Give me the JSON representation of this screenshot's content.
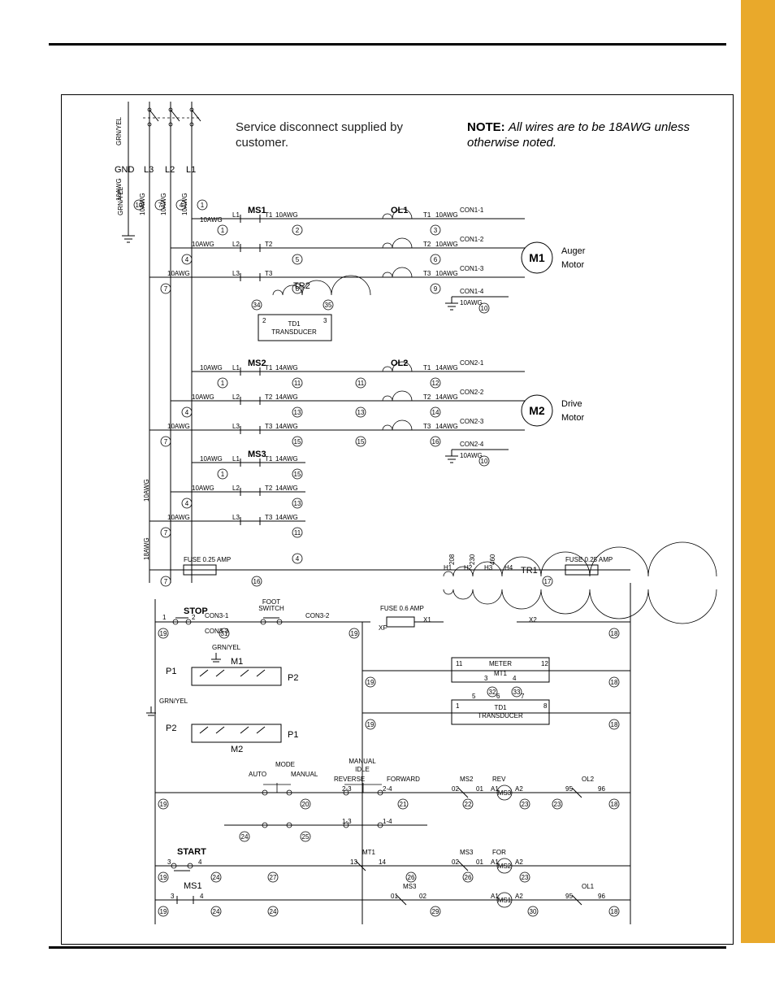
{
  "header": {
    "service": "Service disconnect supplied by customer.",
    "note_label": "NOTE:",
    "note_body": "All wires are to be 18AWG unless otherwise noted."
  },
  "power": {
    "gnd": "GND",
    "lines": [
      "L3",
      "L2",
      "L1"
    ],
    "grnyel": "GRN/YEL",
    "awg10": "10AWG",
    "awg14": "14AWG",
    "awg18": "18AWG"
  },
  "starters": [
    {
      "name": "MS1",
      "ol": "OL1",
      "con_pre": "CON1-",
      "motor": "M1",
      "motor_label": "Auger\nMotor",
      "rows": [
        {
          "L": "L1",
          "T": "T1",
          "left_w": "1",
          "mid_w": "2",
          "right_w": "3",
          "con": "1"
        },
        {
          "L": "L2",
          "T": "T2",
          "left_w": "4",
          "mid_w": "5",
          "right_w": "6",
          "con": "2"
        },
        {
          "L": "L3",
          "T": "T3",
          "left_w": "7",
          "mid_w": "8",
          "right_w": "9",
          "con": "3"
        }
      ],
      "gnd_w": "10",
      "tr": {
        "name": "TR2",
        "left_w": "34",
        "right_w": "35",
        "sub": "TD1\nTRANSDUCER",
        "t2": "2",
        "t3": "3"
      }
    },
    {
      "name": "MS2",
      "ol": "OL2",
      "con_pre": "CON2-",
      "motor": "M2",
      "motor_label": "Drive\nMotor",
      "rows": [
        {
          "L": "L1",
          "T": "T1",
          "left_w": "1",
          "mid_w": "11",
          "right_w": "12",
          "con": "1"
        },
        {
          "L": "L2",
          "T": "T2",
          "left_w": "4",
          "mid_w": "13",
          "right_w": "14",
          "con": "2"
        },
        {
          "L": "L3",
          "T": "T3",
          "left_w": "7",
          "mid_w": "15",
          "right_w": "16",
          "con": "3"
        }
      ],
      "gnd_w": "10"
    },
    {
      "name": "MS3",
      "rows": [
        {
          "L": "L1",
          "T": "T1",
          "left_w": "1",
          "mid_w": "15"
        },
        {
          "L": "L2",
          "T": "T2",
          "left_w": "4",
          "mid_w": "13"
        },
        {
          "L": "L3",
          "T": "T3",
          "left_w": "7",
          "mid_w": "11"
        }
      ]
    }
  ],
  "fuse_line": {
    "fuse_l": "FUSE 0.25 AMP",
    "fuse_r": "FUSE 0.25 AMP",
    "wires": {
      "l": "7",
      "rl": "16",
      "rr": "17",
      "top": "4"
    },
    "trans": {
      "name": "TR1",
      "h": [
        "H1",
        "H2",
        "H3",
        "H4"
      ],
      "v": [
        "208",
        "230",
        "460"
      ]
    }
  },
  "control": {
    "stop": {
      "label": "STOP",
      "n1": "1",
      "n2": "2",
      "foot": "FOOT\nSWITCH",
      "con31": "CON3-1",
      "con32": "CON3-2",
      "con33": "CON3-3",
      "wires": {
        "l": "19",
        "r": "19",
        "mid": "31"
      },
      "grnyel": "GRN/YEL"
    },
    "xfuse": {
      "label": "FUSE 0.6 AMP",
      "xf": "XF",
      "x1": "X1",
      "x2": "X2",
      "w18": "18"
    },
    "meter": {
      "label": "METER",
      "mt1": "MT1",
      "n11": "11",
      "n12": "12",
      "n3": "3",
      "n4": "4",
      "wl": "32",
      "wr": "33",
      "w19": "19",
      "w18": "18"
    },
    "td1": {
      "label": "TD1\nTRANSDUCER",
      "n1": "1",
      "n5": "5",
      "n6": "6",
      "n7": "7",
      "n8": "8",
      "w19": "19",
      "w18": "18"
    },
    "plugs": {
      "p1": "P1",
      "p2": "P2",
      "m1": "M1",
      "m2": "M2",
      "grnyel": "GRN/YEL"
    },
    "mode": {
      "label": "MODE",
      "auto": "AUTO",
      "manual": "MANUAL",
      "idle": "IDLE",
      "forward": "FORWARD",
      "reverse": "REVERSE",
      "w19": "19",
      "w20": "20",
      "w21": "21",
      "w24": "24",
      "w25": "25",
      "n23": "2-3",
      "n24": "2-4",
      "n13": "1-3",
      "n14": "1-4"
    },
    "rev_row": {
      "ms2": "MS2",
      "rev": "REV",
      "ms3": "MS3",
      "a1": "A1",
      "a2": "A2",
      "n01": "01",
      "n02": "02",
      "ol2": "OL2",
      "n95": "95",
      "n96": "96",
      "w22": "22",
      "w23": "23",
      "w18": "18"
    },
    "start": {
      "label": "START",
      "n3": "3",
      "n4": "4",
      "w19": "19",
      "w24": "24",
      "w27": "27",
      "w26": "26"
    },
    "mt1_row": {
      "mt1": "MT1",
      "n13": "13",
      "n14": "14"
    },
    "for_row": {
      "ms3": "MS3",
      "for": "FOR",
      "ms2": "MS2",
      "a1": "A1",
      "a2": "A2",
      "n01": "01",
      "n02": "02",
      "w26": "26",
      "w23": "23"
    },
    "ms1_row": {
      "ms1": "MS1",
      "n3": "3",
      "n4": "4",
      "w19": "19",
      "w24": "24"
    },
    "ms3_row": {
      "ms3": "MS3",
      "n01": "01",
      "n02": "02",
      "w29": "29",
      "ms1": "MS1",
      "a1": "A1",
      "a2": "A2",
      "w30": "30"
    },
    "ol1_row": {
      "ol1": "OL1",
      "n95": "95",
      "n96": "96",
      "w18": "18"
    }
  }
}
